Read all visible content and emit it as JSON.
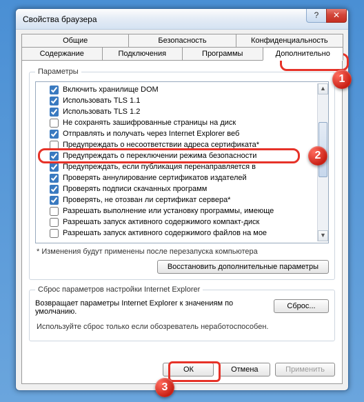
{
  "window": {
    "title": "Свойства браузера",
    "help_glyph": "?",
    "close_glyph": "✕"
  },
  "tabs_row1": [
    {
      "label": "Общие"
    },
    {
      "label": "Безопасность"
    },
    {
      "label": "Конфиденциальность"
    }
  ],
  "tabs_row2": [
    {
      "label": "Содержание"
    },
    {
      "label": "Подключения"
    },
    {
      "label": "Программы"
    },
    {
      "label": "Дополнительно"
    }
  ],
  "active_tab": "Дополнительно",
  "params_legend": "Параметры",
  "settings": [
    {
      "checked": true,
      "label": "Включить хранилище DOM"
    },
    {
      "checked": true,
      "label": "Использовать TLS 1.1"
    },
    {
      "checked": true,
      "label": "Использовать TLS 1.2"
    },
    {
      "checked": false,
      "label": "Не сохранять зашифрованные страницы на диск"
    },
    {
      "checked": true,
      "label": "Отправлять и получать через Internet Explorer веб"
    },
    {
      "checked": false,
      "label": "Предупреждать о несоответствии адреса сертификата*"
    },
    {
      "checked": true,
      "label": "Предупреждать о переключении режима безопасности"
    },
    {
      "checked": true,
      "label": "Предупреждать, если публикация перенаправляется в"
    },
    {
      "checked": true,
      "label": "Проверять аннулирование сертификатов издателей"
    },
    {
      "checked": true,
      "label": "Проверять подписи скачанных программ"
    },
    {
      "checked": true,
      "label": "Проверять, не отозван ли сертификат сервера*"
    },
    {
      "checked": false,
      "label": "Разрешать выполнение или установку программы, имеюще"
    },
    {
      "checked": false,
      "label": "Разрешать запуск активного содержимого компакт-диск"
    },
    {
      "checked": false,
      "label": "Разрешать запуск активного содержимого файлов на мое"
    }
  ],
  "restart_note": "* Изменения будут применены после перезапуска компьютера",
  "restore_btn": "Восстановить дополнительные параметры",
  "reset_legend": "Сброс параметров настройки Internet Explorer",
  "reset_text": "Возвращает параметры Internet Explorer к значениям по умолчанию.",
  "reset_btn": "Сброс...",
  "reset_note": "Используйте сброс только если обозреватель неработоспособен.",
  "ok_btn": "ОК",
  "cancel_btn": "Отмена",
  "apply_btn": "Применить",
  "callouts": {
    "c1": "1",
    "c2": "2",
    "c3": "3"
  }
}
